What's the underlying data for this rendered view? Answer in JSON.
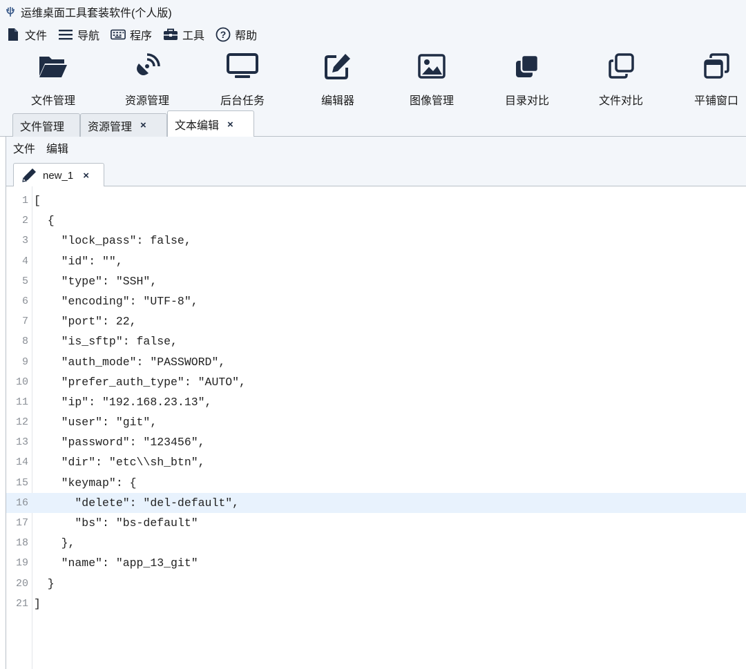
{
  "app": {
    "title": "运维桌面工具套装软件(个人版)"
  },
  "menu": [
    {
      "label": "文件",
      "icon": "file-icon"
    },
    {
      "label": "导航",
      "icon": "menu-lines-icon"
    },
    {
      "label": "程序",
      "icon": "keyboard-icon"
    },
    {
      "label": "工具",
      "icon": "toolbox-icon"
    },
    {
      "label": "帮助",
      "icon": "help-icon"
    }
  ],
  "toolbar": [
    {
      "label": "文件管理",
      "icon": "folder-open-icon"
    },
    {
      "label": "资源管理",
      "icon": "satellite-icon"
    },
    {
      "label": "后台任务",
      "icon": "monitor-icon"
    },
    {
      "label": "编辑器",
      "icon": "edit-icon"
    },
    {
      "label": "图像管理",
      "icon": "image-icon"
    },
    {
      "label": "目录对比",
      "icon": "stacked-squares-icon"
    },
    {
      "label": "文件对比",
      "icon": "copy-icon"
    },
    {
      "label": "平铺窗口",
      "icon": "windows-icon"
    }
  ],
  "module_tabs": [
    {
      "label": "文件管理",
      "closable": false,
      "active": false
    },
    {
      "label": "资源管理",
      "closable": true,
      "active": false
    },
    {
      "label": "文本编辑",
      "closable": true,
      "active": true
    }
  ],
  "submenu": [
    "文件",
    "编辑"
  ],
  "editor_tab": {
    "label": "new_1",
    "close": "×"
  },
  "close_symbol": "×",
  "colors": {
    "chrome_bg": "#f3f6fa",
    "icon_blue": "#1f2d44",
    "current_line": "#e8f2fd"
  },
  "editor": {
    "current_line": 16,
    "lines": [
      "[",
      "  {",
      "    \"lock_pass\": false,",
      "    \"id\": \"\",",
      "    \"type\": \"SSH\",",
      "    \"encoding\": \"UTF-8\",",
      "    \"port\": 22,",
      "    \"is_sftp\": false,",
      "    \"auth_mode\": \"PASSWORD\",",
      "    \"prefer_auth_type\": \"AUTO\",",
      "    \"ip\": \"192.168.23.13\",",
      "    \"user\": \"git\",",
      "    \"password\": \"123456\",",
      "    \"dir\": \"etc\\\\sh_btn\",",
      "    \"keymap\": {",
      "      \"delete\": \"del-default\",",
      "      \"bs\": \"bs-default\"",
      "    },",
      "    \"name\": \"app_13_git\"",
      "  }",
      "]"
    ]
  }
}
